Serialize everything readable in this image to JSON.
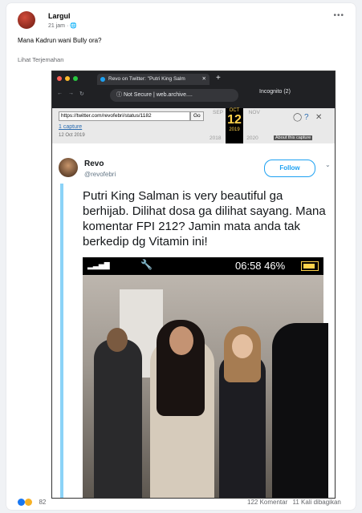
{
  "post": {
    "author": "Largul",
    "time": "21 jam",
    "privacy_icon": "globe-icon",
    "caption": "Mana Kadrun wani Bully ora?",
    "translate": "Lihat Terjemahan",
    "reactions_count": "82",
    "comments": "122 Komentar",
    "shares": "11 Kali dibagikan"
  },
  "browser": {
    "tab_title": "Revo on Twitter: \"Putri King Salm",
    "new_tab": "+",
    "not_secure": "Not Secure",
    "address": "web.archive....",
    "incognito": "Incognito (2)"
  },
  "wayback": {
    "url": "https://twitter.com/revofebri/status/1182",
    "go": "Go",
    "capture": "1 capture",
    "capture_date": "12 Oct 2019",
    "prev_month": "SEP",
    "month": "OCT",
    "next_month": "NOV",
    "day": "12",
    "prev_year": "2018",
    "year": "2019",
    "next_year": "2020",
    "about": "About this capture"
  },
  "tweet": {
    "name": "Revo",
    "handle": "@revofebri",
    "follow": "Follow",
    "text": "Putri King Salman is very beautiful ga berhijab. Dilihat dosa ga dilihat sayang. Mana komentar FPI 212? Jamin mata anda tak berkedip dg Vitamin ini!"
  },
  "phone": {
    "clock": "06:58",
    "battery": "46%"
  },
  "colors": {
    "follow": "#1da1f2",
    "thread": "#8bd3f7"
  }
}
